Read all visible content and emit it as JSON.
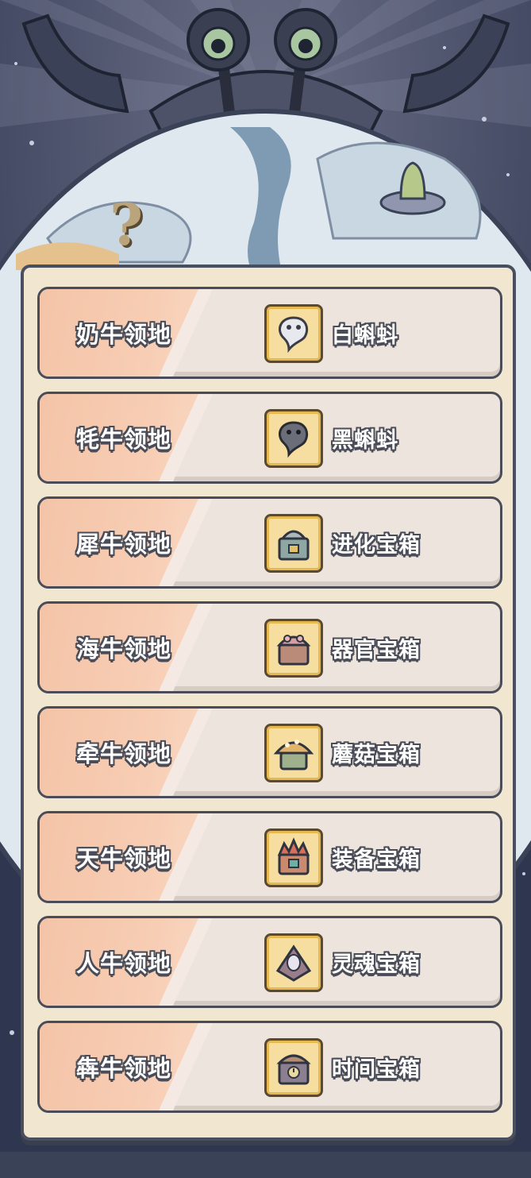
{
  "decor": {
    "mystery_mark": "?"
  },
  "colors": {
    "panel_bg": "#f1e6d0",
    "row_bg": "#ece4dd",
    "stripe": "#f4c4a8",
    "outline": "#4a4d58",
    "icon_bg": "#f6dea0"
  },
  "rows": [
    {
      "territory": "奶牛领地",
      "reward": "白蝌蚪",
      "icon": "white-tadpole-icon"
    },
    {
      "territory": "牦牛领地",
      "reward": "黑蝌蚪",
      "icon": "black-tadpole-icon"
    },
    {
      "territory": "犀牛领地",
      "reward": "进化宝箱",
      "icon": "evolution-chest-icon"
    },
    {
      "territory": "海牛领地",
      "reward": "器官宝箱",
      "icon": "organ-chest-icon"
    },
    {
      "territory": "牵牛领地",
      "reward": "蘑菇宝箱",
      "icon": "mushroom-chest-icon"
    },
    {
      "territory": "天牛领地",
      "reward": "装备宝箱",
      "icon": "equipment-chest-icon"
    },
    {
      "territory": "人牛领地",
      "reward": "灵魂宝箱",
      "icon": "soul-chest-icon"
    },
    {
      "territory": "犇牛领地",
      "reward": "时间宝箱",
      "icon": "time-chest-icon"
    }
  ]
}
